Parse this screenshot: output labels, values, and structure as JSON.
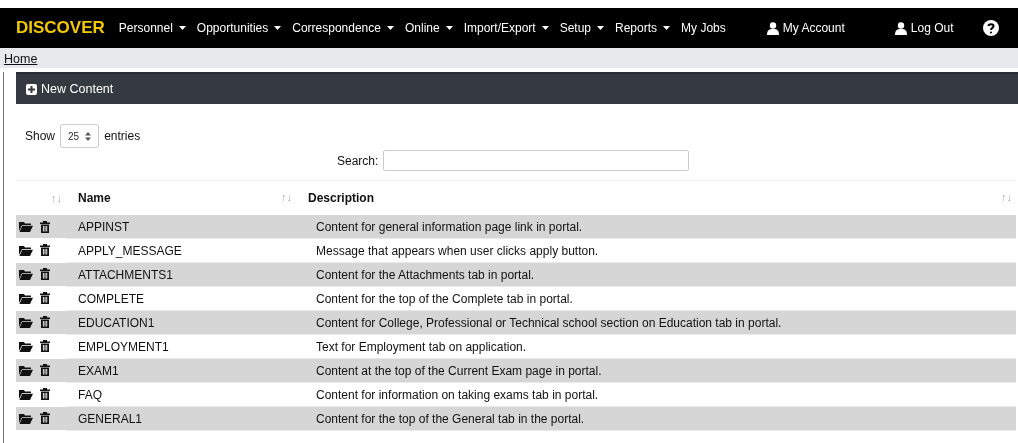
{
  "nav": {
    "brand": "DISCOVER",
    "menu": [
      {
        "label": "Personnel",
        "dropdown": true
      },
      {
        "label": "Opportunities",
        "dropdown": true
      },
      {
        "label": "Correspondence",
        "dropdown": true
      },
      {
        "label": "Online",
        "dropdown": true
      },
      {
        "label": "Import/Export",
        "dropdown": true
      },
      {
        "label": "Setup",
        "dropdown": true
      },
      {
        "label": "Reports",
        "dropdown": true
      },
      {
        "label": "My Jobs",
        "dropdown": false
      }
    ],
    "account": [
      {
        "label": "My Account"
      },
      {
        "label": "Log Out"
      }
    ]
  },
  "breadcrumb": "Home",
  "toolbar": {
    "button": "New Content"
  },
  "length": {
    "before": "Show",
    "value": "25",
    "after": "entries"
  },
  "search": {
    "label": "Search:"
  },
  "table": {
    "columns": [
      {
        "sort": "↑↓"
      },
      {
        "label": "Name",
        "sort": "↑↓"
      },
      {
        "label": "Description",
        "sort": "↑↓"
      }
    ],
    "rows": [
      {
        "name": "APPINST",
        "description": "Content for general information page link in portal."
      },
      {
        "name": "APPLY_MESSAGE",
        "description": "Message that appears when user clicks apply button."
      },
      {
        "name": "ATTACHMENTS1",
        "description": "Content for the Attachments tab in portal."
      },
      {
        "name": "COMPLETE",
        "description": "Content for the top of the Complete tab in portal."
      },
      {
        "name": "EDUCATION1",
        "description": "Content for College, Professional or Technical school section on Education tab in portal."
      },
      {
        "name": "EMPLOYMENT1",
        "description": "Text for Employment tab on application."
      },
      {
        "name": "EXAM1",
        "description": "Content at the top of the Current Exam page in portal."
      },
      {
        "name": "FAQ",
        "description": "Content for information on taking exams tab in portal."
      },
      {
        "name": "GENERAL1",
        "description": "Content for the top of the General tab in the portal."
      }
    ]
  }
}
